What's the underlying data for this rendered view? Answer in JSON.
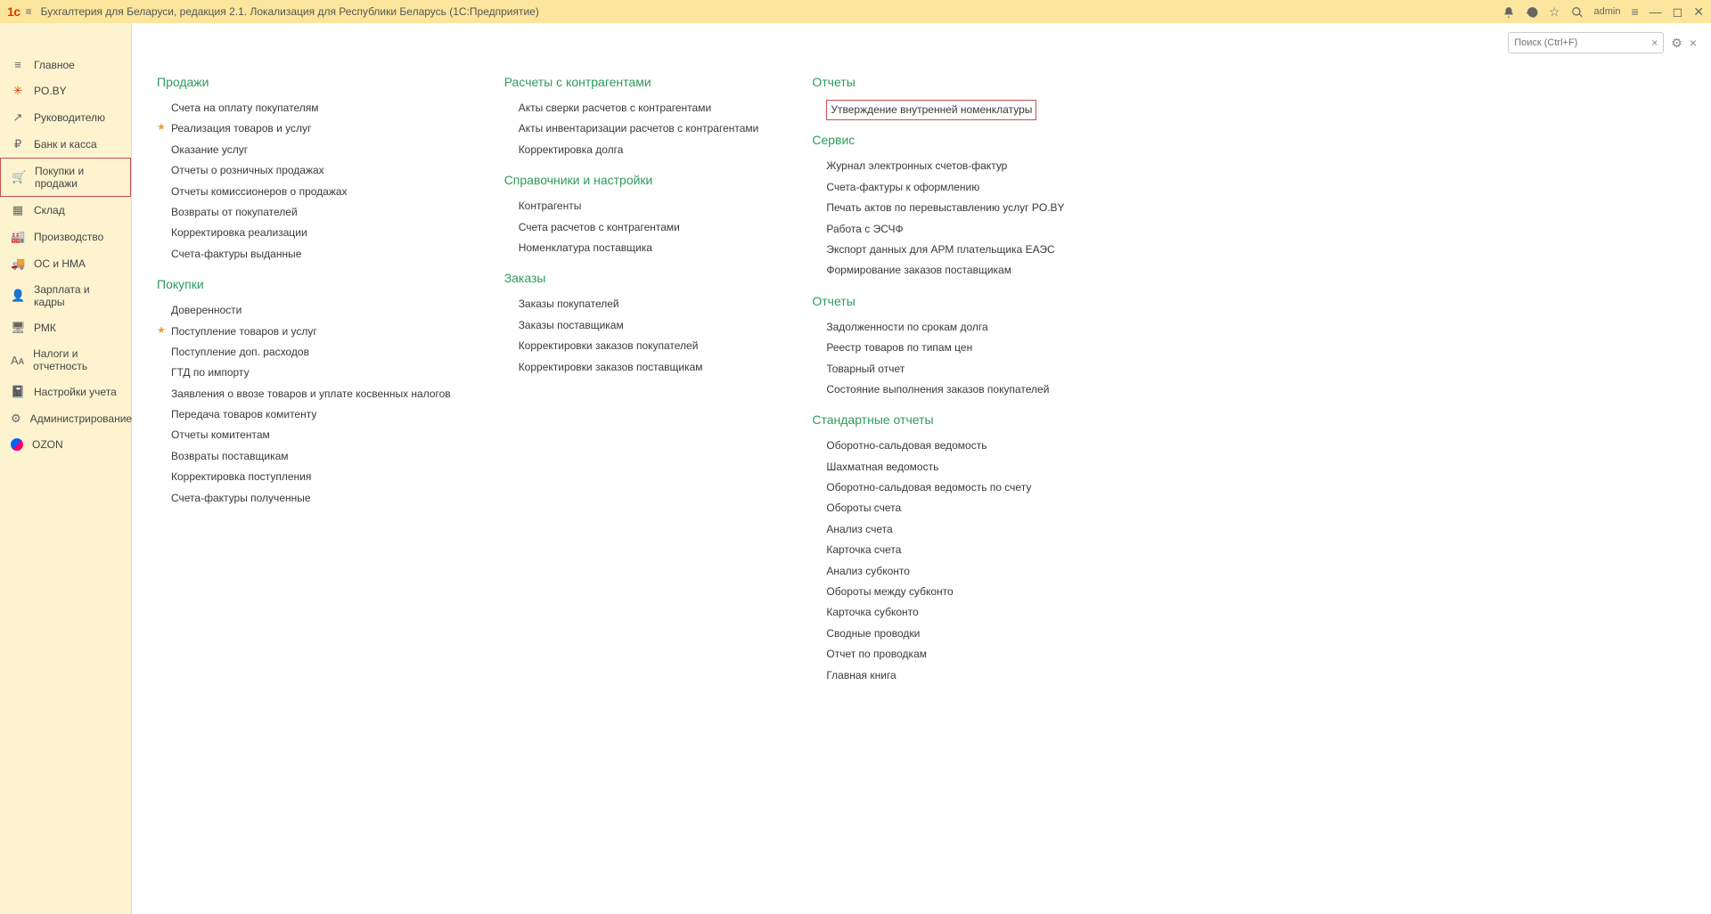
{
  "titlebar": {
    "logo": "1с",
    "title": "Бухгалтерия для Беларуси, редакция 2.1. Локализация для Республики Беларусь   (1С:Предприятие)",
    "user": "admin"
  },
  "search": {
    "placeholder": "Поиск (Ctrl+F)"
  },
  "sidebar": [
    {
      "label": "Главное",
      "icon": "≡"
    },
    {
      "label": "PO.BY",
      "icon": "✳",
      "red": true
    },
    {
      "label": "Руководителю",
      "icon": "↗"
    },
    {
      "label": "Банк и касса",
      "icon": "₽"
    },
    {
      "label": "Покупки и продажи",
      "icon": "🛒",
      "active": true
    },
    {
      "label": "Склад",
      "icon": "▦"
    },
    {
      "label": "Производство",
      "icon": "🏭"
    },
    {
      "label": "ОС и НМА",
      "icon": "🚚"
    },
    {
      "label": "Зарплата и кадры",
      "icon": "👤"
    },
    {
      "label": "РМК",
      "icon": "🖥"
    },
    {
      "label": "Налоги и отчетность",
      "icon": "Aᴀ"
    },
    {
      "label": "Настройки учета",
      "icon": "📓"
    },
    {
      "label": "Администрирование",
      "icon": "⚙"
    },
    {
      "label": "OZON",
      "icon": "ozon"
    }
  ],
  "col1": [
    {
      "title": "Продажи",
      "items": [
        {
          "t": "Счета на оплату покупателям"
        },
        {
          "t": "Реализация товаров и услуг",
          "star": true
        },
        {
          "t": "Оказание услуг"
        },
        {
          "t": "Отчеты о розничных продажах"
        },
        {
          "t": "Отчеты комиссионеров о продажах"
        },
        {
          "t": "Возвраты от покупателей"
        },
        {
          "t": "Корректировка реализации"
        },
        {
          "t": "Счета-фактуры выданные"
        }
      ]
    },
    {
      "title": "Покупки",
      "items": [
        {
          "t": "Доверенности"
        },
        {
          "t": "Поступление товаров и услуг",
          "star": true
        },
        {
          "t": "Поступление доп. расходов"
        },
        {
          "t": "ГТД по импорту"
        },
        {
          "t": "Заявления о ввозе товаров и уплате косвенных налогов"
        },
        {
          "t": "Передача товаров комитенту"
        },
        {
          "t": "Отчеты комитентам"
        },
        {
          "t": "Возвраты поставщикам"
        },
        {
          "t": "Корректировка поступления"
        },
        {
          "t": "Счета-фактуры полученные"
        }
      ]
    }
  ],
  "col2": [
    {
      "title": "Расчеты с контрагентами",
      "items": [
        {
          "t": "Акты сверки расчетов с контрагентами"
        },
        {
          "t": "Акты инвентаризации расчетов с контрагентами"
        },
        {
          "t": "Корректировка долга"
        }
      ]
    },
    {
      "title": "Справочники и настройки",
      "items": [
        {
          "t": "Контрагенты"
        },
        {
          "t": "Счета расчетов с контрагентами"
        },
        {
          "t": "Номенклатура поставщика"
        }
      ]
    },
    {
      "title": "Заказы",
      "items": [
        {
          "t": "Заказы покупателей"
        },
        {
          "t": "Заказы поставщикам"
        },
        {
          "t": "Корректировки заказов покупателей"
        },
        {
          "t": "Корректировки заказов поставщикам"
        }
      ]
    }
  ],
  "col3": [
    {
      "title": "Отчеты",
      "items": [
        {
          "t": "Утверждение внутренней номенклатуры",
          "box": true
        }
      ]
    },
    {
      "title": "Сервис",
      "items": [
        {
          "t": "Журнал электронных счетов-фактур"
        },
        {
          "t": "Счета-фактуры к оформлению"
        },
        {
          "t": "Печать актов по перевыставлению услуг PO.BY"
        },
        {
          "t": "Работа с ЭСЧФ"
        },
        {
          "t": "Экспорт данных для АРМ плательщика ЕАЭС"
        },
        {
          "t": "Формирование заказов поставщикам"
        }
      ]
    },
    {
      "title": "Отчеты",
      "items": [
        {
          "t": "Задолженности по срокам долга"
        },
        {
          "t": "Реестр товаров по типам цен"
        },
        {
          "t": "Товарный отчет"
        },
        {
          "t": "Состояние выполнения заказов покупателей"
        }
      ]
    },
    {
      "title": "Стандартные отчеты",
      "items": [
        {
          "t": "Оборотно-сальдовая ведомость"
        },
        {
          "t": "Шахматная ведомость"
        },
        {
          "t": "Оборотно-сальдовая ведомость по счету"
        },
        {
          "t": "Обороты счета"
        },
        {
          "t": "Анализ счета"
        },
        {
          "t": "Карточка счета"
        },
        {
          "t": "Анализ субконто"
        },
        {
          "t": "Обороты между субконто"
        },
        {
          "t": "Карточка субконто"
        },
        {
          "t": "Сводные проводки"
        },
        {
          "t": "Отчет по проводкам"
        },
        {
          "t": "Главная книга"
        }
      ]
    }
  ]
}
